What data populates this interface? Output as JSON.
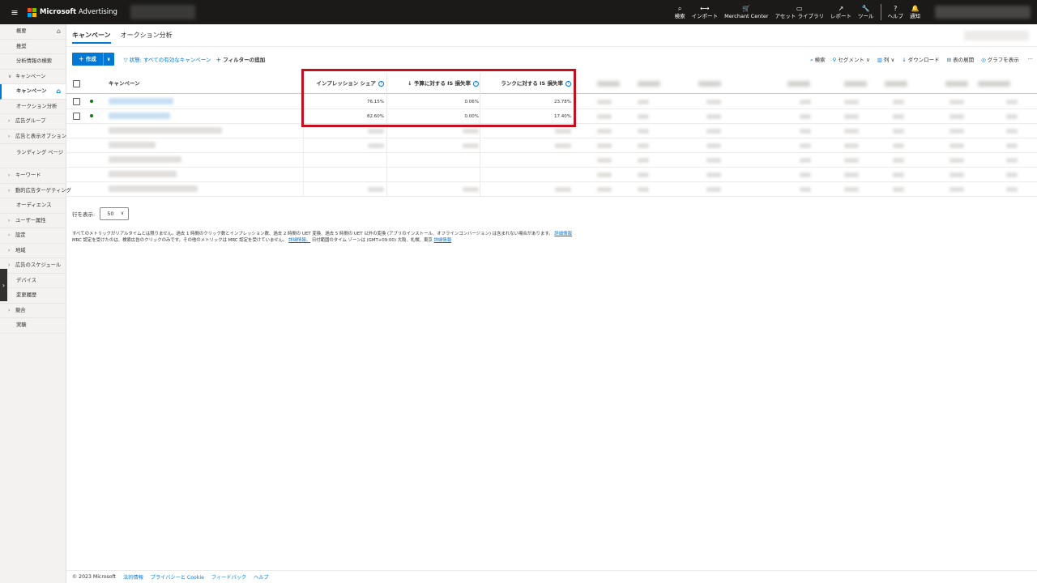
{
  "brand": {
    "name": "Microsoft",
    "product": "Advertising"
  },
  "topnav": [
    {
      "icon": "⌕",
      "icon_name": "search-icon",
      "label": "検索"
    },
    {
      "icon": "⟷",
      "icon_name": "import-icon",
      "label": "インポート"
    },
    {
      "icon": "🛒",
      "icon_name": "cart-icon",
      "label": "Merchant Center"
    },
    {
      "icon": "▭",
      "icon_name": "asset-library-icon",
      "label": "アセット ライブラリ"
    },
    {
      "icon": "↗",
      "icon_name": "reports-icon",
      "label": "レポート"
    },
    {
      "icon": "🔧",
      "icon_name": "tools-icon",
      "label": "ツール"
    },
    {
      "icon": "?",
      "icon_name": "help-icon",
      "label": "ヘルプ"
    },
    {
      "icon": "🔔",
      "icon_name": "notification-icon",
      "label": "通知"
    }
  ],
  "sidebar": {
    "items": [
      {
        "label": "概要",
        "type": "top",
        "home": true
      },
      {
        "label": "推奨",
        "type": "top"
      },
      {
        "label": "分析情報の検索",
        "type": "top"
      },
      {
        "label": "キャンペーン",
        "type": "group",
        "chev": "∨"
      },
      {
        "label": "キャンペーン",
        "type": "active",
        "home": true
      },
      {
        "label": "オークション分析",
        "type": "child"
      },
      {
        "label": "広告グループ",
        "type": "group",
        "chev": "›"
      },
      {
        "label": "広告と表示オプション",
        "type": "group",
        "chev": "›"
      },
      {
        "label": "ランディング ページ",
        "type": "tall"
      },
      {
        "label": "キーワード",
        "type": "group",
        "chev": "›"
      },
      {
        "label": "動的広告ターゲティング",
        "type": "group",
        "chev": "›"
      },
      {
        "label": "オーディエンス",
        "type": "child"
      },
      {
        "label": "ユーザー属性",
        "type": "group",
        "chev": "›"
      },
      {
        "label": "設定",
        "type": "group",
        "chev": "›"
      },
      {
        "label": "地域",
        "type": "group",
        "chev": "›"
      },
      {
        "label": "広告のスケジュール",
        "type": "group",
        "chev": "›"
      },
      {
        "label": "デバイス",
        "type": "child"
      },
      {
        "label": "変更履歴",
        "type": "child"
      },
      {
        "label": "競合",
        "type": "group",
        "chev": "›"
      },
      {
        "label": "実験",
        "type": "child"
      }
    ]
  },
  "tabs": [
    {
      "label": "キャンペーン",
      "active": true
    },
    {
      "label": "オークション分析",
      "active": false
    }
  ],
  "toolbar": {
    "create": "＋ 作成",
    "create_drop": "∨",
    "filter_status": "状態: すべての有効なキャンペーン",
    "add_filter": "フィルターの追加",
    "right_items": [
      {
        "icon": "⌕",
        "label": "検索"
      },
      {
        "icon": "⚲",
        "label": "セグメント ∨"
      },
      {
        "icon": "▥",
        "label": "列 ∨"
      },
      {
        "icon": "↓",
        "label": "ダウンロード"
      },
      {
        "icon": "⊞",
        "label": "表の展開"
      },
      {
        "icon": "◎",
        "label": "グラフを表示"
      },
      {
        "icon": "",
        "label": "···"
      }
    ]
  },
  "table": {
    "columns": {
      "campaign": "キャンペーン",
      "impression_share": "インプレッション シェア",
      "budget_lost": "↓ 予算に対する IS 損失率",
      "rank_lost": "ランクに対する IS 損失率"
    },
    "rows": [
      {
        "impression_share": "76.15%",
        "budget_lost": "0.06%",
        "rank_lost": "23.78%",
        "active": true
      },
      {
        "impression_share": "82.60%",
        "budget_lost": "0.00%",
        "rank_lost": "17.40%",
        "active": true
      },
      {
        "impression_share": "",
        "budget_lost": "",
        "rank_lost": "",
        "active": false
      },
      {
        "impression_share": "",
        "budget_lost": "",
        "rank_lost": "",
        "active": false
      },
      {
        "impression_share": "",
        "budget_lost": "",
        "rank_lost": "",
        "active": false
      },
      {
        "impression_share": "",
        "budget_lost": "",
        "rank_lost": "",
        "active": false
      },
      {
        "impression_share": "",
        "budget_lost": "",
        "rank_lost": "",
        "active": false
      }
    ]
  },
  "pagination": {
    "label": "行を表示:",
    "value": "50"
  },
  "notes": {
    "line1": "すべてのメトリックがリアルタイムとは限りません。過去 1 時間のクリック数とインプレッション数、過去 2 時間の UET 変換、過去 5 時間の UET 以外の変換 (アプリのインストール、オフラインコンバージョン) は含まれない場合があります。",
    "line1_link": "詳細情報",
    "line2a": "MRC 認定を受けたのは、検索広告のクリックのみです。その他のメトリックは MRC 認定を受けていません。",
    "line2_link1": "詳細情報。",
    "line2b": "日付範囲のタイム ゾーンは (GMT+09:00) 大阪、札幌、東京",
    "line2_link2": "詳細情報"
  },
  "footer": {
    "copyright": "© 2023 Microsoft",
    "links": [
      "法的情報",
      "プライバシーと Cookie",
      "フィードバック",
      "ヘルプ"
    ]
  },
  "colors": {
    "accent": "#0078d4",
    "highlight": "#c50f1f",
    "topbar": "#1b1a19",
    "status_active": "#107c10"
  }
}
